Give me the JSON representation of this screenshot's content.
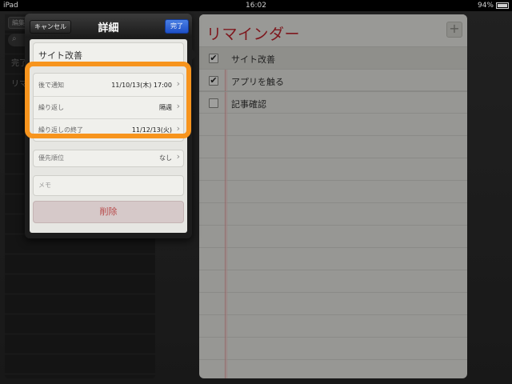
{
  "status_bar": {
    "device": "iPad",
    "time": "16:02",
    "battery": "94%"
  },
  "left_panel": {
    "edit_label": "編集",
    "items": [
      "完了",
      "リマ"
    ]
  },
  "notebook": {
    "title": "リマインダー",
    "add_label": "+",
    "reminders": [
      {
        "label": "サイト改善",
        "checked": true
      },
      {
        "label": "アプリを触る",
        "checked": true
      },
      {
        "label": "記事確認",
        "checked": false
      }
    ]
  },
  "popover": {
    "cancel_label": "キャンセル",
    "title": "詳細",
    "done_label": "完了",
    "item_title": "サイト改善",
    "details": [
      {
        "label": "後で通知",
        "value": "11/10/13(木) 17:00"
      },
      {
        "label": "繰り返し",
        "value": "隔週"
      },
      {
        "label": "繰り返しの終了",
        "value": "11/12/13(火)"
      }
    ],
    "priority_label": "優先順位",
    "priority_value": "なし",
    "memo_placeholder": "メモ",
    "delete_label": "削除"
  },
  "colors": {
    "highlight": "#f7941d",
    "title_red": "#c2262f",
    "done_blue": "#2a5fd6"
  }
}
